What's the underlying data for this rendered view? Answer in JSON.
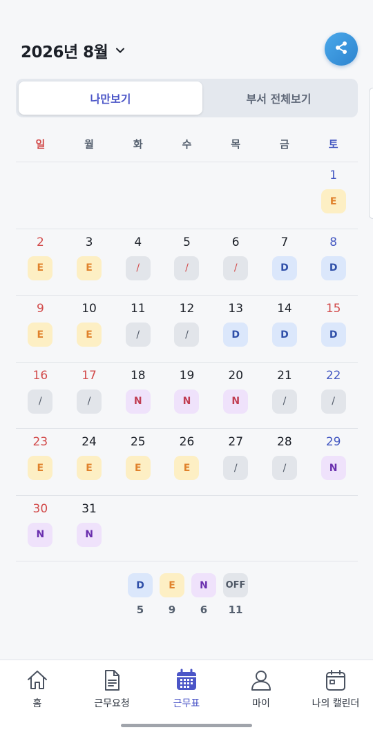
{
  "header": {
    "month_title": "2026년 8월"
  },
  "toggle": {
    "mine": "나만보기",
    "dept": "부서 전체보기"
  },
  "weekdays": [
    "일",
    "월",
    "화",
    "수",
    "목",
    "금",
    "토"
  ],
  "weeks": [
    [
      null,
      null,
      null,
      null,
      null,
      null,
      {
        "d": "1",
        "t": "E"
      }
    ],
    [
      {
        "d": "2",
        "t": "E"
      },
      {
        "d": "3",
        "t": "E"
      },
      {
        "d": "4",
        "t": "/"
      },
      {
        "d": "5",
        "t": "/"
      },
      {
        "d": "6",
        "t": "/"
      },
      {
        "d": "7",
        "t": "D"
      },
      {
        "d": "8",
        "t": "D"
      }
    ],
    [
      {
        "d": "9",
        "t": "E"
      },
      {
        "d": "10",
        "t": "E"
      },
      {
        "d": "11",
        "t": "/"
      },
      {
        "d": "12",
        "t": "/"
      },
      {
        "d": "13",
        "t": "D"
      },
      {
        "d": "14",
        "t": "D"
      },
      {
        "d": "15",
        "t": "D"
      }
    ],
    [
      {
        "d": "16",
        "t": "/"
      },
      {
        "d": "17",
        "t": "/"
      },
      {
        "d": "18",
        "t": "N"
      },
      {
        "d": "19",
        "t": "N"
      },
      {
        "d": "20",
        "t": "N"
      },
      {
        "d": "21",
        "t": "/"
      },
      {
        "d": "22",
        "t": "/"
      }
    ],
    [
      {
        "d": "23",
        "t": "E"
      },
      {
        "d": "24",
        "t": "E"
      },
      {
        "d": "25",
        "t": "E"
      },
      {
        "d": "26",
        "t": "E"
      },
      {
        "d": "27",
        "t": "/"
      },
      {
        "d": "28",
        "t": "/"
      },
      {
        "d": "29",
        "t": "N"
      }
    ],
    [
      {
        "d": "30",
        "t": "N"
      },
      {
        "d": "31",
        "t": "N"
      },
      null,
      null,
      null,
      null,
      null
    ]
  ],
  "summary": [
    {
      "label": "D",
      "count": "5"
    },
    {
      "label": "E",
      "count": "9"
    },
    {
      "label": "N",
      "count": "6"
    },
    {
      "label": "OFF",
      "count": "11"
    }
  ],
  "nav": {
    "home": "홈",
    "request": "근무요청",
    "schedule": "근무표",
    "my": "마이",
    "calendar": "나의 캘린더"
  },
  "colors": {
    "accent": "#4b55c7",
    "sunday": "#d24b4b",
    "saturday": "#4559c2"
  }
}
